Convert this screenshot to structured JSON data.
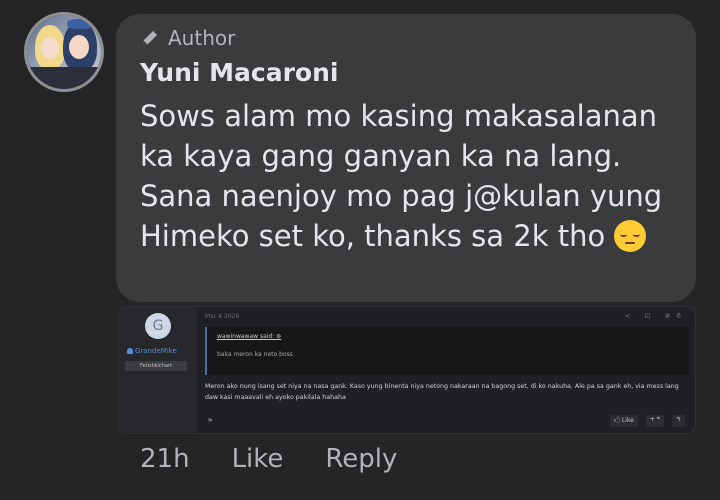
{
  "comment": {
    "badge_label": "Author",
    "author_name": "Yuni Macaroni",
    "message": "Sows alam mo kasing makasalanan ka kaya gang ganyan ka na lang. Sana naenjoy mo pag j@kulan yung Himeko set ko, thanks sa 2k tho",
    "emoji": "pensive-face"
  },
  "attachment": {
    "avatar_letter": "G",
    "username": "GrandeMike",
    "user_role": "Fetishkichart",
    "date": "Mar 4 2026",
    "share_icons": "< ⊡ #6",
    "quote_author": "wawinwawaw said: ⊛",
    "quote_text": "baka meron ka neto boss",
    "post_body": "Meron ako nung isang set niya na nasa gank. Kaso yung binenta niya netong nakaraan na bagong set, di ko nakuha. Ale pa sa gank eh, via mess lang daw kasi maaavali eh ayoko pakilala hahaha",
    "flag_icon": "⚑",
    "like_action": "🖒 Like",
    "quote_action": "+ ❝",
    "reply_action": "↰"
  },
  "meta": {
    "time": "21h",
    "like": "Like",
    "reply": "Reply"
  }
}
